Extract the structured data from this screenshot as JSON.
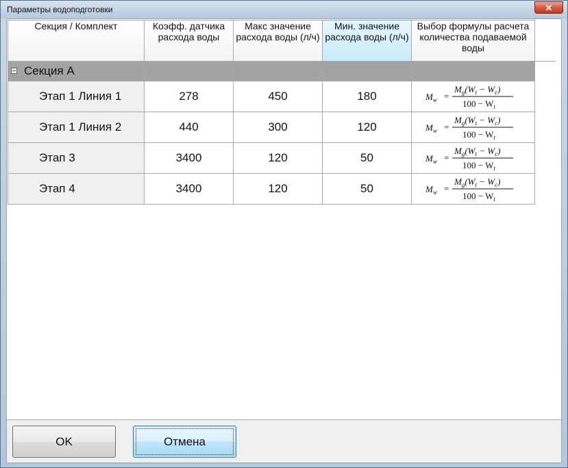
{
  "window": {
    "title": "Параметры водоподготовки",
    "close_glyph": "✕"
  },
  "table": {
    "columns": [
      "Секция / Комплект",
      "Коэфф. датчика расхода воды",
      "Макс значение расхода воды (л/ч)",
      "Мин. значение расхода воды (л/ч)",
      "Выбор формулы расчета количества подаваемой воды"
    ],
    "group": {
      "label": "Секция А",
      "expander": "collapse-icon"
    },
    "rows": [
      {
        "name": "Этап 1 Линия 1",
        "coef": "278",
        "max": "450",
        "min": "180"
      },
      {
        "name": "Этап 1 Линия 2",
        "coef": "440",
        "max": "300",
        "min": "120"
      },
      {
        "name": "Этап 3",
        "coef": "3400",
        "max": "120",
        "min": "50"
      },
      {
        "name": "Этап 4",
        "coef": "3400",
        "max": "120",
        "min": "50"
      }
    ],
    "formula": {
      "lhs": "M",
      "lhs_sub": "w",
      "eq": "=",
      "num_main": "M",
      "num_sub": "g",
      "num_open": "(W",
      "num_sub2": "t",
      "num_minus": " − W",
      "num_sub3": "c",
      "num_close": ")",
      "den_main": "100 − W",
      "den_sub": "t"
    }
  },
  "buttons": {
    "ok": "OK",
    "cancel": "Отмена"
  },
  "colors": {
    "group_bg": "#a3a3a3",
    "selected_header": "#c9ebfb",
    "close": "#c03a22"
  }
}
